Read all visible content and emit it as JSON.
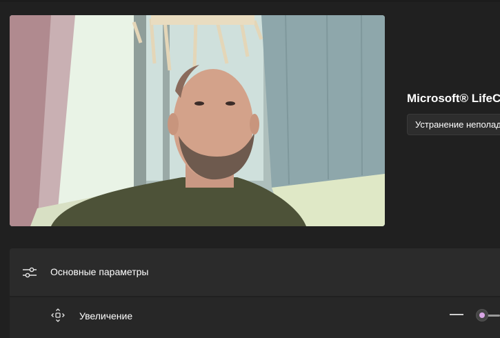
{
  "camera": {
    "device_name": "Microsoft® LifeCam",
    "troubleshoot_label": "Устранение неполадок"
  },
  "settings": {
    "basic_header_label": "Основные параметры",
    "basic_header_icon": "sliders-icon",
    "zoom_label": "Увеличение",
    "zoom_icon": "move-arrows-icon",
    "zoom_level": 0,
    "accent_color": "#d9a6e6"
  },
  "colors": {
    "background": "#202020",
    "panel": "#2b2b2b",
    "row": "#272727"
  }
}
